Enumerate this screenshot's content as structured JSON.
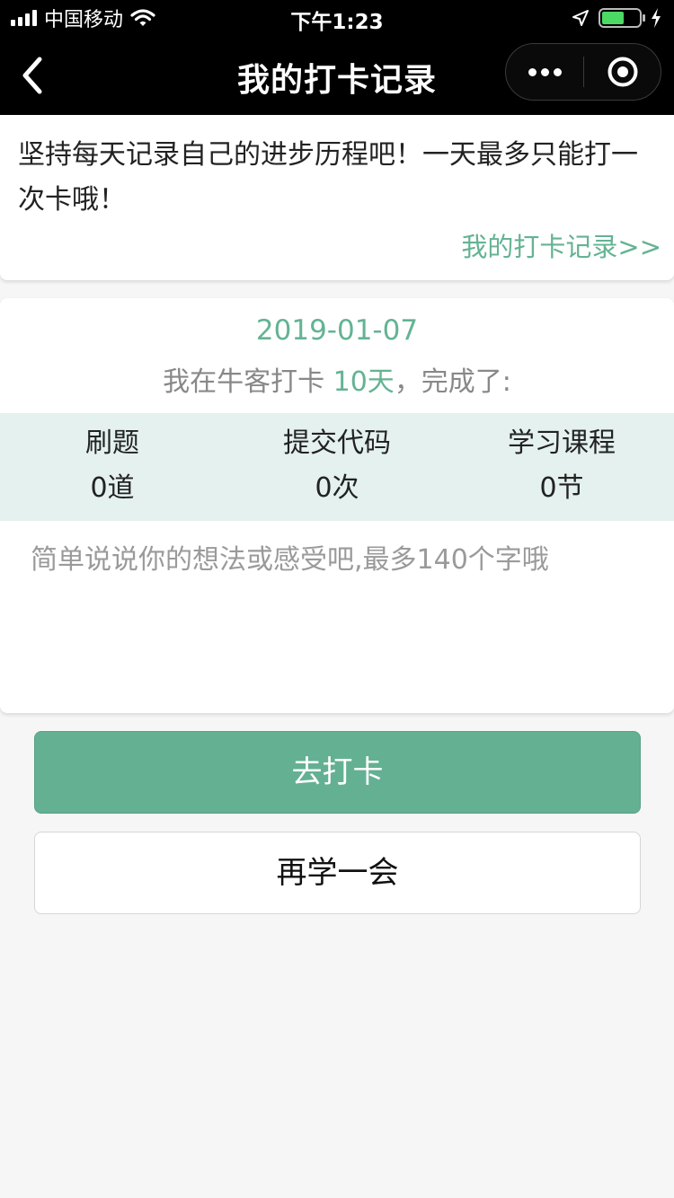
{
  "status_bar": {
    "carrier": "中国移动",
    "time": "下午1:23"
  },
  "nav": {
    "title": "我的打卡记录"
  },
  "intro": {
    "text": "坚持每天记录自己的进步历程吧！一天最多只能打一次卡哦！",
    "link_label": "我的打卡记录>>"
  },
  "checkin": {
    "date": "2019-01-07",
    "summary_prefix": "我在牛客打卡 ",
    "days": "10天",
    "summary_suffix": "，完成了:",
    "stats": [
      {
        "label": "刷题",
        "value": "0道"
      },
      {
        "label": "提交代码",
        "value": "0次"
      },
      {
        "label": "学习课程",
        "value": "0节"
      }
    ],
    "thoughts_placeholder": "简单说说你的想法或感受吧,最多140个字哦"
  },
  "buttons": {
    "checkin_label": "去打卡",
    "study_more_label": "再学一会"
  },
  "colors": {
    "accent": "#64b393",
    "button_primary": "#64b093",
    "stats_bg": "#e4f1ee",
    "nav_bg": "#000000"
  },
  "icons": {
    "back": "chevron-left-icon",
    "more": "more-dots-icon",
    "close": "target-circle-icon",
    "wifi": "wifi-icon",
    "location": "location-arrow-icon",
    "battery": "battery-icon",
    "charging": "bolt-icon"
  }
}
